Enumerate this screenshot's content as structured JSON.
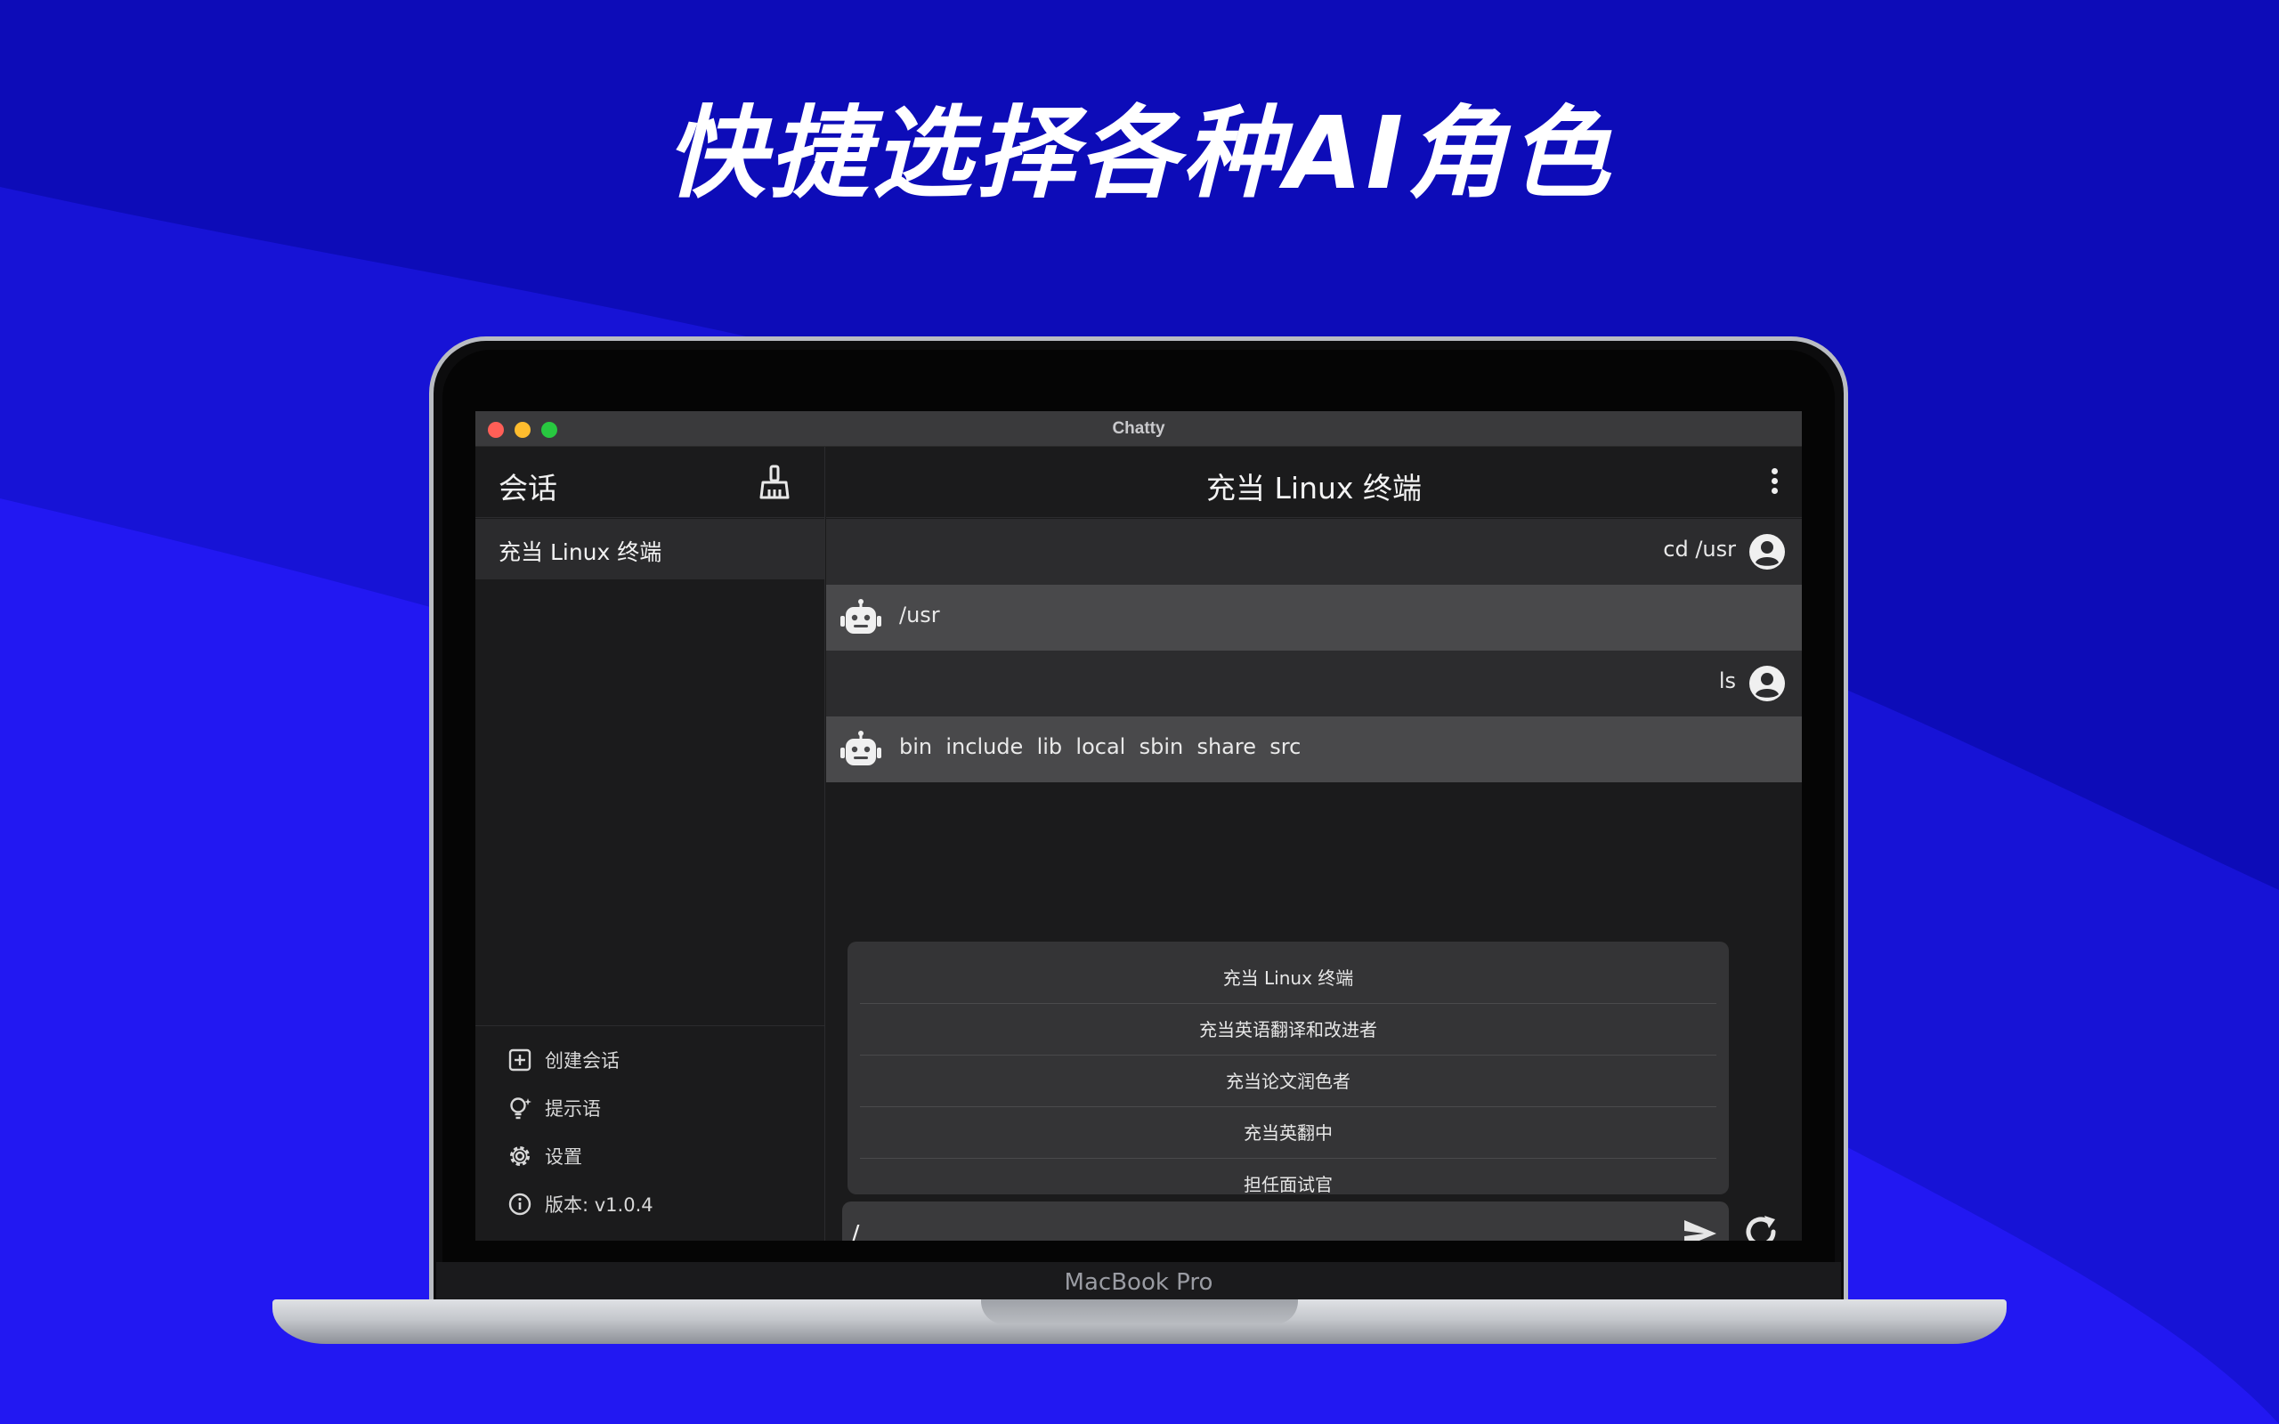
{
  "headline": "快捷选择各种AI角色",
  "device": {
    "brand": "MacBook Pro"
  },
  "window": {
    "title": "Chatty"
  },
  "sidebar": {
    "title": "会话",
    "clear_icon": "broom-icon",
    "conversations": [
      {
        "label": "充当 Linux 终端"
      }
    ],
    "footer": [
      {
        "label": "创建会话",
        "icon": "add-square-icon"
      },
      {
        "label": "提示语",
        "icon": "lightbulb-icon"
      },
      {
        "label": "设置",
        "icon": "gear-icon"
      },
      {
        "label": "版本: v1.0.4",
        "icon": "info-icon"
      }
    ]
  },
  "main": {
    "title": "充当 Linux 终端",
    "menu_icon": "kebab-menu-icon",
    "messages": [
      {
        "role": "user",
        "text": "cd /usr",
        "icon": "user-avatar-icon"
      },
      {
        "role": "bot",
        "text": "/usr",
        "icon": "robot-icon"
      },
      {
        "role": "user",
        "text": "ls",
        "icon": "user-avatar-icon"
      },
      {
        "role": "bot",
        "text": "bin  include  lib  local  sbin  share  src",
        "icon": "robot-icon"
      }
    ],
    "prompt_options": [
      "充当 Linux 终端",
      "充当英语翻译和改进者",
      "充当论文润色者",
      "充当英翻中",
      "担任面试官"
    ],
    "input": {
      "value": "/",
      "send_icon": "send-icon"
    },
    "refresh_icon": "refresh-icon"
  },
  "colors": {
    "background": "#1410d8",
    "window_bg": "#1b1b1c",
    "user_row": "#2c2c2e",
    "bot_row": "#49494b"
  }
}
